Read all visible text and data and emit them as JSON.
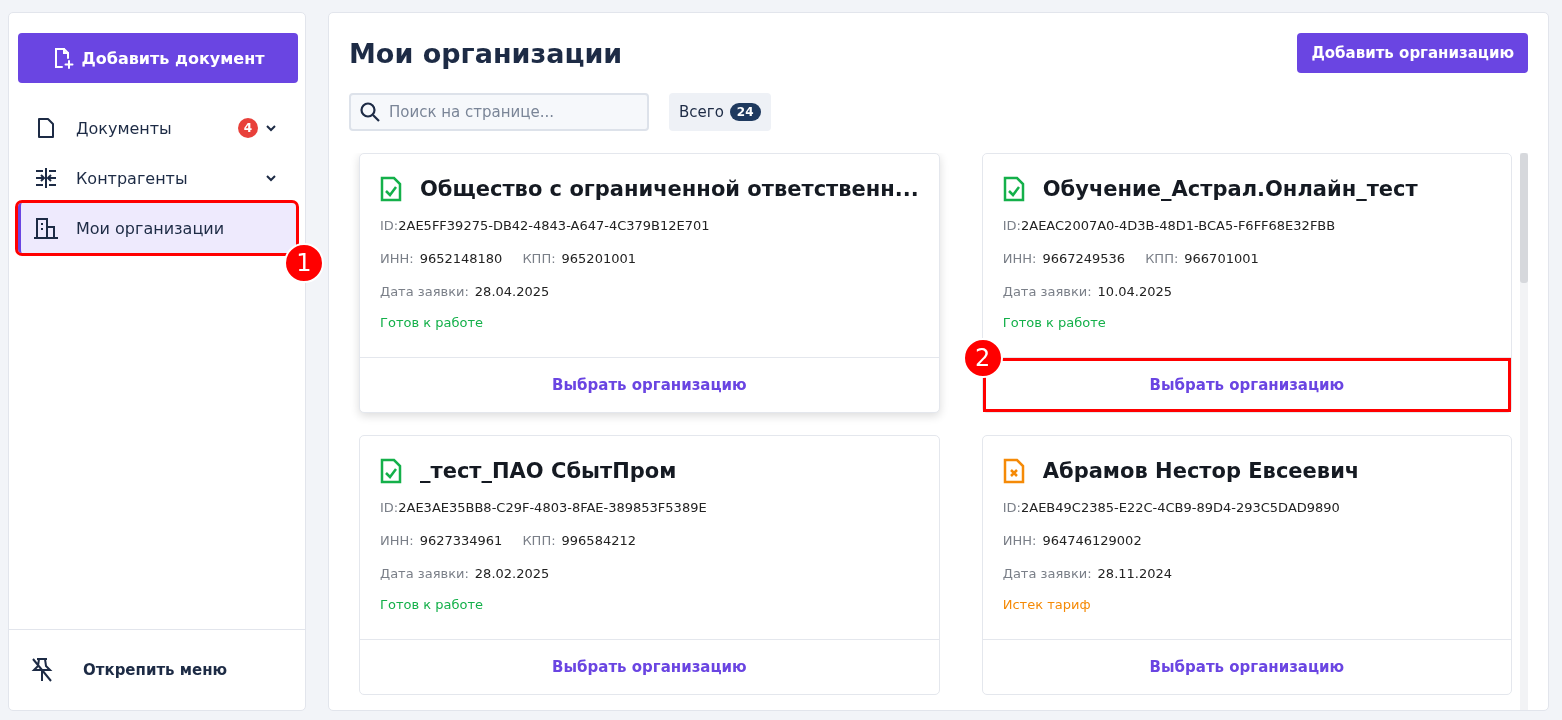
{
  "sidebar": {
    "add_button": "Добавить документ",
    "items": [
      {
        "label": "Документы",
        "badge": "4",
        "expandable": true,
        "selected": false
      },
      {
        "label": "Контрагенты",
        "expandable": true,
        "selected": false
      },
      {
        "label": "Мои организации",
        "expandable": false,
        "selected": true,
        "callout": "1"
      }
    ],
    "footer": "Открепить меню"
  },
  "main": {
    "title": "Мои организации",
    "add_button": "Добавить организацию",
    "search": {
      "placeholder": "Поиск на странице..."
    },
    "total": {
      "label": "Всего",
      "count": "24"
    },
    "cards": [
      {
        "name": "Общество с ограниченной ответственн...",
        "color": "#14b04a",
        "id_label": "ID:",
        "id": "2AE5FF39275-DB42-4843-A647-4C379B12E701",
        "inn_label": "ИНН:",
        "inn": "9652148180",
        "kpp_label": "КПП:",
        "kpp": "965201001",
        "date_label": "Дата заявки:",
        "date": "28.04.2025",
        "status": "Готов к работе",
        "button": "Выбрать организацию",
        "hovered": true
      },
      {
        "name": "Обучение_Астрал.Онлайн_тест",
        "color": "#14b04a",
        "id_label": "ID:",
        "id": "2AEAC2007A0-4D3B-48D1-BCA5-F6FF68E32FBB",
        "inn_label": "ИНН:",
        "inn": "9667249536",
        "kpp_label": "КПП:",
        "kpp": "966701001",
        "date_label": "Дата заявки:",
        "date": "10.04.2025",
        "status": "Готов к работе",
        "button": "Выбрать организацию",
        "hovered": false,
        "callout": "2"
      },
      {
        "name": "_тест_ПАО СбытПром",
        "color": "#14b04a",
        "id_label": "ID:",
        "id": "2AE3AE35BB8-C29F-4803-8FAE-389853F5389E",
        "inn_label": "ИНН:",
        "inn": "9627334961",
        "kpp_label": "КПП:",
        "kpp": "996584212",
        "date_label": "Дата заявки:",
        "date": "28.02.2025",
        "status": "Готов к работе",
        "button": "Выбрать организацию",
        "hovered": false
      },
      {
        "name": "Абрамов Нестор Евсеевич",
        "color": "#f58a07",
        "id_label": "ID:",
        "id": "2AEB49C2385-E22C-4CB9-89D4-293C5DAD9890",
        "inn_label": "ИНН:",
        "inn": "964746129002",
        "date_label": "Дата заявки:",
        "date": "28.11.2024",
        "status": "Истек тариф",
        "button": "Выбрать организацию",
        "hovered": false
      }
    ]
  }
}
